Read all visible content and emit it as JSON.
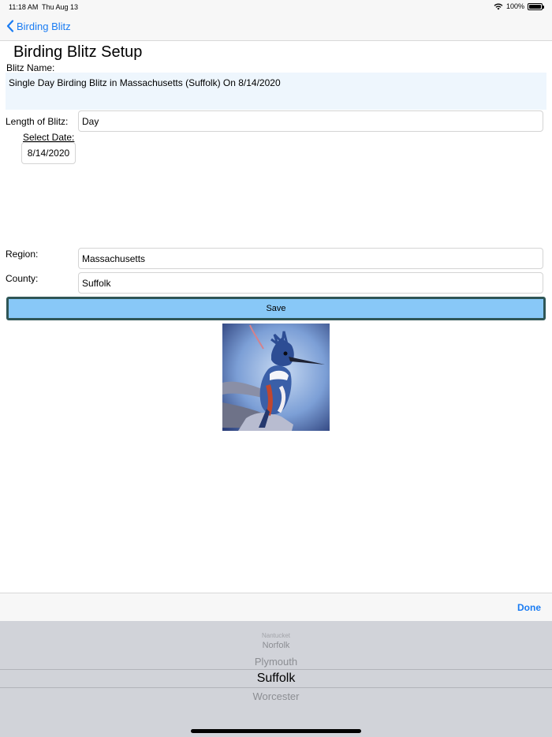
{
  "status_bar": {
    "time": "11:18 AM",
    "date": "Thu Aug 13",
    "battery": "100%"
  },
  "nav": {
    "back_label": "Birding Blitz"
  },
  "page": {
    "title": "Birding Blitz Setup"
  },
  "form": {
    "blitz_name_label": "Blitz Name:",
    "blitz_name_value": "Single Day Birding Blitz in Massachusetts  (Suffolk) On 8/14/2020",
    "length_label": "Length of Blitz:",
    "length_value": "Day",
    "select_date_label": "Select Date:",
    "date_value": "8/14/2020",
    "region_label": "Region:",
    "region_value": "Massachusetts",
    "county_label": "County:",
    "county_value": "Suffolk",
    "save_label": "Save"
  },
  "accessory": {
    "done_label": "Done"
  },
  "picker": {
    "items": [
      "Nantucket",
      "Norfolk",
      "Plymouth",
      "Suffolk",
      "Worcester"
    ],
    "selected": "Suffolk"
  },
  "colors": {
    "accent": "#1a7cf3",
    "save_fill": "#88c8f7",
    "save_border": "#2f5656",
    "name_box": "#eef6fd"
  }
}
